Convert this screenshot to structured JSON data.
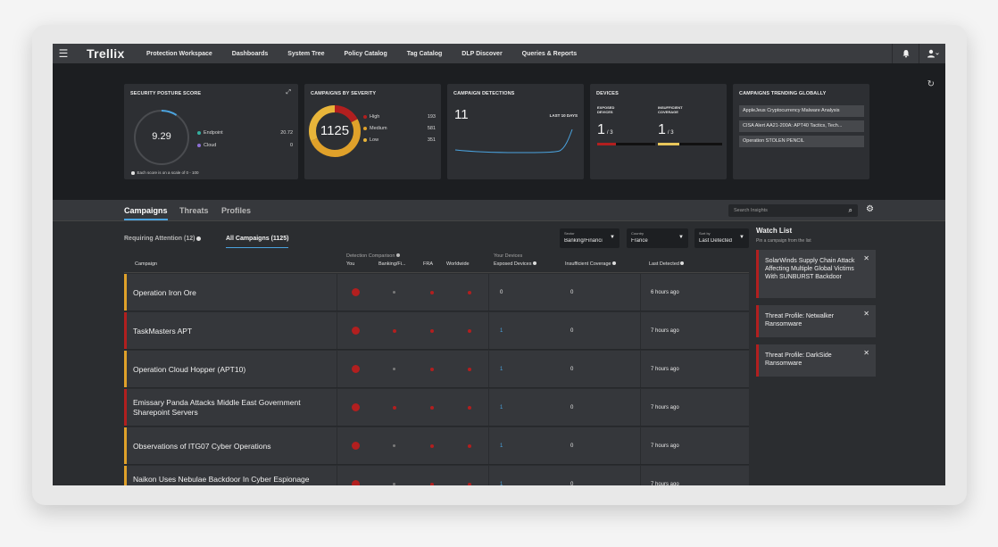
{
  "topnav": {
    "logo": "Trellix",
    "items": [
      "Protection Workspace",
      "Dashboards",
      "System Tree",
      "Policy Catalog",
      "Tag Catalog",
      "DLP Discover",
      "Queries & Reports"
    ]
  },
  "cards": {
    "posture": {
      "title": "SECURITY POSTURE SCORE",
      "score": "9.29",
      "endpoint_label": "Endpoint",
      "endpoint_value": "20.72",
      "cloud_label": "Cloud",
      "cloud_value": "0",
      "footnote": "Each score is on a scale of 0 - 100",
      "score_fraction": 0.0929
    },
    "severity": {
      "title": "CAMPAIGNS BY SEVERITY",
      "total": "1125",
      "high_label": "High",
      "high_value": "193",
      "medium_label": "Medium",
      "medium_value": "581",
      "low_label": "Low",
      "low_value": "351"
    },
    "detections": {
      "title": "CAMPAIGN DETECTIONS",
      "count": "11",
      "period": "LAST 10 DAYS"
    },
    "devices": {
      "title": "DEVICES",
      "exposed_label_1": "EXPOSED",
      "exposed_label_2": "DEVICES",
      "exposed_value": "1",
      "exposed_total": "/ 3",
      "insufficient_label_1": "INSUFFICIENT",
      "insufficient_label_2": "COVERAGE",
      "insufficient_value": "1",
      "insufficient_total": "/ 3"
    },
    "trending": {
      "title": "CAMPAIGNS TRENDING GLOBALLY",
      "items": [
        "AppleJeus Cryptocurrency Malware Analysis",
        "CISA Alert AA21-200A: APT40 Tactics, Tech...",
        "Operation STOLEN PENCIL"
      ]
    }
  },
  "tabs": [
    "Campaigns",
    "Threats",
    "Profiles"
  ],
  "search": {
    "placeholder": "Search Insights"
  },
  "subtabs": {
    "attention": "Requiring Attention (12)",
    "all": "All Campaigns (1125)"
  },
  "filters": {
    "sector": {
      "label": "Sector",
      "value": "Banking/Financi"
    },
    "country": {
      "label": "Country",
      "value": "France"
    },
    "sort": {
      "label": "Sort by",
      "value": "Last Detected"
    }
  },
  "table": {
    "campaign_header": "Campaign",
    "group_detection": "Detection Comparison",
    "group_devices": "Your Devices",
    "col_you": "You",
    "col_banking": "Banking/Fi...",
    "col_fra": "FRA",
    "col_worldwide": "Worldwide",
    "col_exposed": "Exposed Devices",
    "col_insufficient": "Insufficient Coverage",
    "col_last": "Last Detected",
    "rows": [
      {
        "name": "Operation Iron Ore",
        "exposed": "0",
        "insufficient": "0",
        "last": "6 hours ago",
        "color": "#e0a12a",
        "banking": "gray"
      },
      {
        "name": "TaskMasters APT",
        "exposed": "1",
        "insufficient": "0",
        "last": "7 hours ago",
        "color": "#b21f1f",
        "banking": "red"
      },
      {
        "name": "Operation Cloud Hopper (APT10)",
        "exposed": "1",
        "insufficient": "0",
        "last": "7 hours ago",
        "color": "#e0a12a",
        "banking": "gray"
      },
      {
        "name": "Emissary Panda Attacks Middle East Government Sharepoint Servers",
        "exposed": "1",
        "insufficient": "0",
        "last": "7 hours ago",
        "color": "#b21f1f",
        "banking": "red"
      },
      {
        "name": "Observations of ITG07 Cyber Operations",
        "exposed": "1",
        "insufficient": "0",
        "last": "7 hours ago",
        "color": "#e0a12a",
        "banking": "gray"
      },
      {
        "name": "Naikon Uses Nebulae Backdoor In Cyber Espionage",
        "exposed": "1",
        "insufficient": "0",
        "last": "7 hours ago",
        "color": "#e0a12a",
        "banking": "gray"
      }
    ]
  },
  "watchlist": {
    "title": "Watch List",
    "subtitle": "Pin a campaign from the list",
    "items": [
      "SolarWinds Supply Chain Attack Affecting Multiple Global Victims With SUNBURST Backdoor",
      "Threat Profile: Netwalker Ransomware",
      "Threat Profile: DarkSide Ransomware"
    ]
  },
  "colors": {
    "accent": "#4aa3df",
    "high": "#b21f1f",
    "medium": "#e0a12a",
    "low": "#e8b53a",
    "line": "#4aa3df"
  }
}
